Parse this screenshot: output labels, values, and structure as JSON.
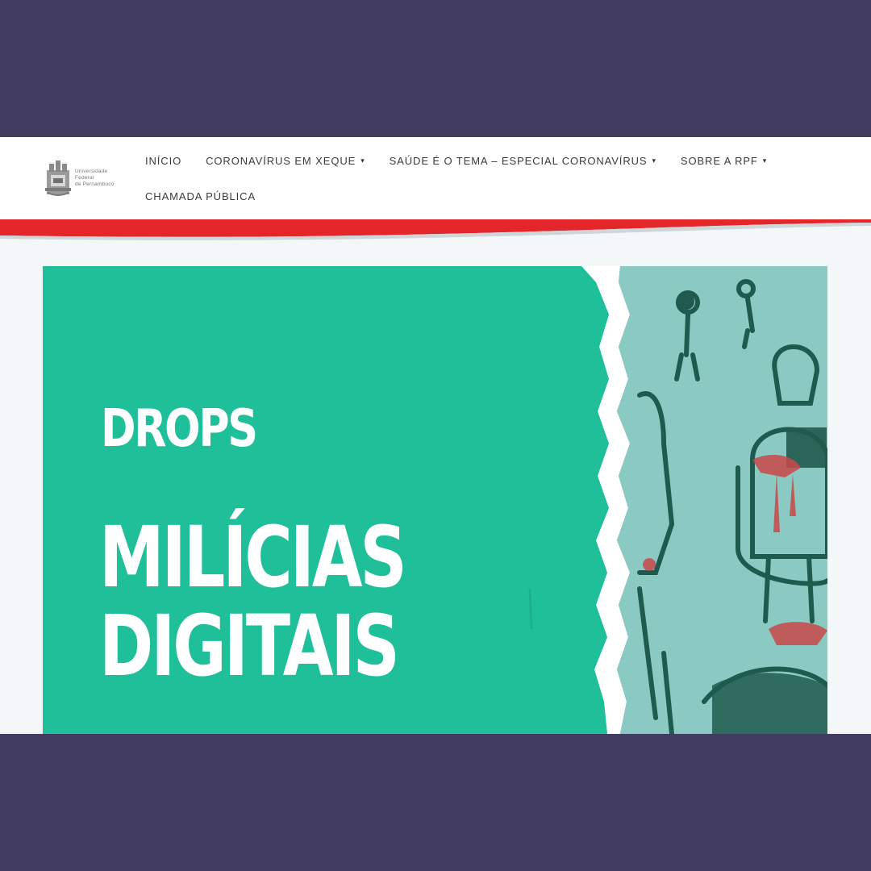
{
  "header": {
    "logo": {
      "line1": "Universidade",
      "line2": "Federal",
      "line3": "de Pernambuco"
    }
  },
  "nav": {
    "items": [
      {
        "label": "INÍCIO",
        "has_dropdown": false
      },
      {
        "label": "CORONAVÍRUS EM XEQUE",
        "has_dropdown": true
      },
      {
        "label": "SAÚDE É O TEMA – ESPECIAL CORONAVÍRUS",
        "has_dropdown": true
      },
      {
        "label": "SOBRE A RPF",
        "has_dropdown": true
      },
      {
        "label": "CHAMADA PÚBLICA",
        "has_dropdown": false
      }
    ],
    "dropdown_glyph": "▾"
  },
  "hero": {
    "kicker": "DROPS",
    "title_line1": "MILÍCIAS",
    "title_line2": "DIGITAIS",
    "illustration": "torn-paper-drawing-of-medical-workers"
  },
  "colors": {
    "frame": "#433c61",
    "hero_green": "#1ebf99",
    "accent_red": "#e3262a",
    "nav_text": "#3a3a3a"
  }
}
